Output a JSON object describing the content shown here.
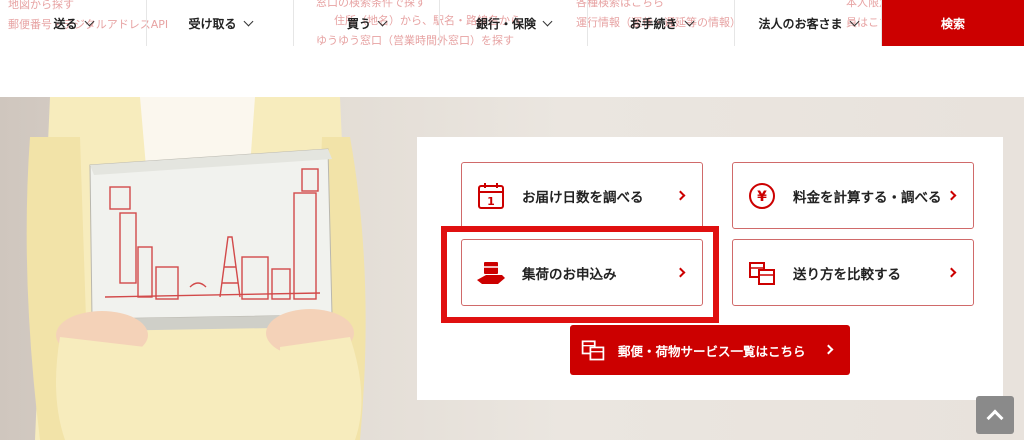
{
  "background_links": [
    "地図から探す",
    "郵便番号・デジタルアドレスAPI",
    "窓口の検索条件で探す",
    "住所（地名）から、駅名・路線名から",
    "ゆうゆう窓口（営業時間外窓口）を探す",
    "各種検索はこちら",
    "運行情報（運休・遅延等の情報）",
    "本人限定",
    "員はこちら"
  ],
  "nav": {
    "items": [
      "送る",
      "受け取る",
      "買う",
      "銀行・保険",
      "お手続き",
      "法人のお客さま"
    ],
    "search_label": "検索"
  },
  "services": {
    "delivery_days": "お届け日数を調べる",
    "calc_fee": "料金を計算する・調べる",
    "pickup_request": "集荷のお申込み",
    "compare_methods": "送り方を比較する",
    "calendar_day": "1",
    "yen_symbol": "¥"
  },
  "list_button": {
    "label": "郵便・荷物サービス一覧はこちら"
  },
  "colors": {
    "brand_red": "#cc0000",
    "highlight_red": "#e01010"
  },
  "icons": [
    "calendar-icon",
    "yen-icon",
    "truck-icon",
    "packages-icon",
    "page-top-icon"
  ]
}
